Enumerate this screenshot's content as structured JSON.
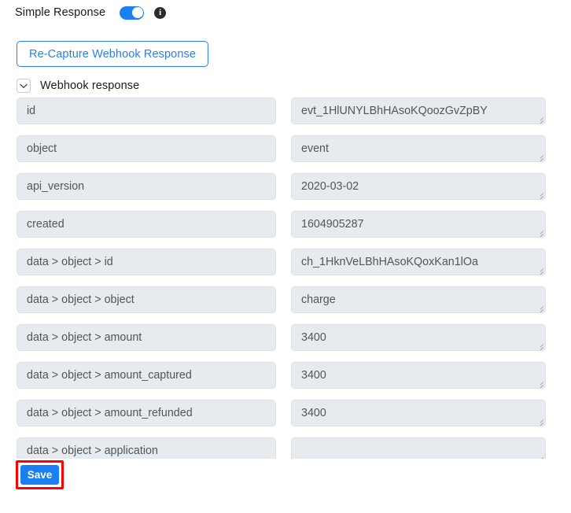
{
  "header": {
    "label": "Simple Response",
    "toggle_on": true,
    "toggle_color": "#1a7ef5",
    "info_icon": "info-icon",
    "info_glyph": "i"
  },
  "actions": {
    "recapture_label": "Re-Capture Webhook Response",
    "recapture_color": "#2a7ef0",
    "save_label": "Save",
    "save_color": "#1a7ef5",
    "save_highlight_color": "#fd0000"
  },
  "section": {
    "title": "Webhook response",
    "expanded": true,
    "caret_icon": "chevron-down-icon"
  },
  "fields": [
    {
      "key": "id",
      "value": "evt_1HlUNYLBhHAsoKQoozGvZpBY"
    },
    {
      "key": "object",
      "value": "event"
    },
    {
      "key": "api_version",
      "value": "2020-03-02"
    },
    {
      "key": "created",
      "value": "1604905287"
    },
    {
      "key": "data > object > id",
      "value": "ch_1HknVeLBhHAsoKQoxKan1lOa"
    },
    {
      "key": "data > object > object",
      "value": "charge"
    },
    {
      "key": "data > object > amount",
      "value": "3400"
    },
    {
      "key": "data > object > amount_captured",
      "value": "3400"
    },
    {
      "key": "data > object > amount_refunded",
      "value": "3400"
    },
    {
      "key": "data > object > application",
      "value": ""
    }
  ]
}
